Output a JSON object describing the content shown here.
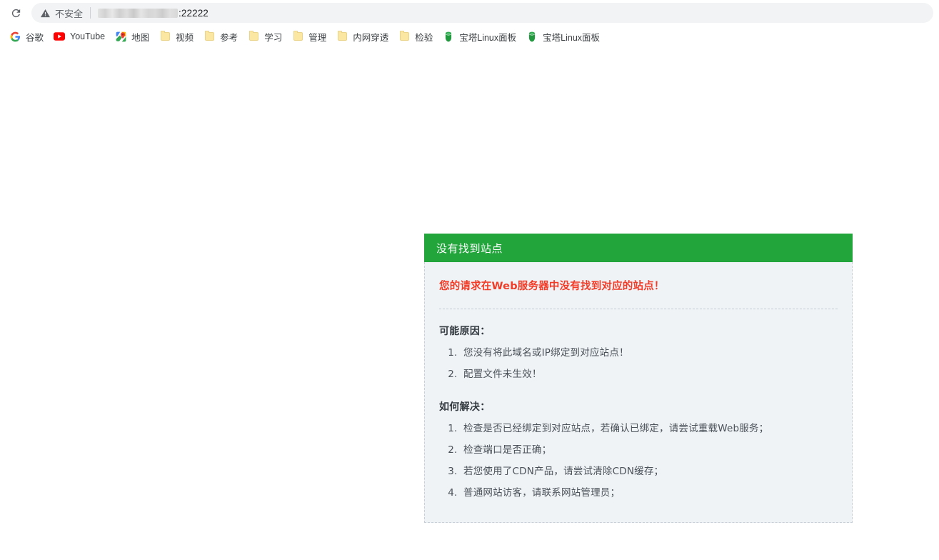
{
  "browser": {
    "reload_icon": "reload-icon",
    "omnibox": {
      "security_icon": "warning-triangle-icon",
      "security_label": "不安全",
      "url_host_redacted": true,
      "url_visible": ":22222"
    },
    "bookmarks": [
      {
        "label": "谷歌",
        "icon": "google-g-icon"
      },
      {
        "label": "YouTube",
        "icon": "youtube-icon"
      },
      {
        "label": "地图",
        "icon": "google-maps-icon"
      },
      {
        "label": "视频",
        "icon": "folder-icon"
      },
      {
        "label": "参考",
        "icon": "folder-icon"
      },
      {
        "label": "学习",
        "icon": "folder-icon"
      },
      {
        "label": "管理",
        "icon": "folder-icon"
      },
      {
        "label": "内网穿透",
        "icon": "folder-icon"
      },
      {
        "label": "检验",
        "icon": "folder-icon"
      },
      {
        "label": "宝塔Linux面板",
        "icon": "bt-panel-icon"
      },
      {
        "label": "宝塔Linux面板",
        "icon": "bt-panel-icon"
      }
    ]
  },
  "page": {
    "panel": {
      "title": "没有找到站点",
      "alert": "您的请求在Web服务器中没有找到对应的站点！",
      "reasons_heading": "可能原因：",
      "reasons": [
        "您没有将此域名或IP绑定到对应站点！",
        "配置文件未生效！"
      ],
      "solutions_heading": "如何解决：",
      "solutions": [
        "检查是否已经绑定到对应站点，若确认已绑定，请尝试重载Web服务；",
        "检查端口是否正确；",
        "若您使用了CDN产品，请尝试清除CDN缓存；",
        "普通网站访客，请联系网站管理员；"
      ]
    }
  },
  "colors": {
    "header_green": "#22a63c",
    "alert_red": "#f33c27",
    "panel_body_bg": "#eff3f6",
    "panel_border": "#c8cfd6"
  }
}
